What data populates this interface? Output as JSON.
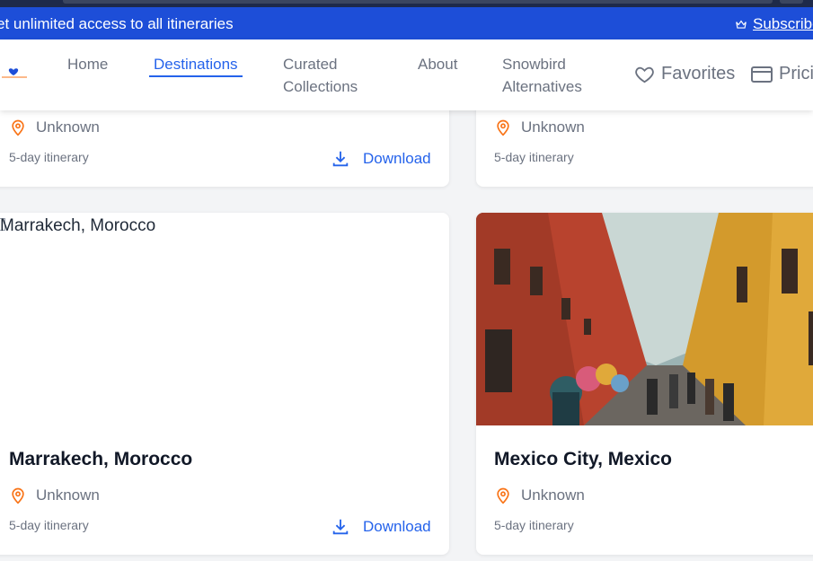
{
  "banner": {
    "message": "et unlimited access to all itineraries",
    "subscribe_label": "Subscribe"
  },
  "nav": {
    "items": [
      {
        "label": "Home"
      },
      {
        "label": "Destinations",
        "active": true
      },
      {
        "label": "Curated Collections"
      },
      {
        "label": "About"
      },
      {
        "label": "Snowbird Alternatives"
      }
    ],
    "favorites_label": "Favorites",
    "pricing_label": "Pricing"
  },
  "cards": [
    {
      "location": "Unknown",
      "duration": "5-day itinerary",
      "download_label": "Download"
    },
    {
      "location": "Unknown",
      "duration": "5-day itinerary"
    },
    {
      "title": "Marrakech, Morocco",
      "image_alt": "Marrakech, Morocco",
      "location": "Unknown",
      "duration": "5-day itinerary",
      "download_label": "Download"
    },
    {
      "title": "Mexico City, Mexico",
      "location": "Unknown",
      "duration": "5-day itinerary"
    }
  ],
  "colors": {
    "primary": "#2563eb",
    "banner": "#1d4ed8",
    "pin": "#f97316"
  }
}
